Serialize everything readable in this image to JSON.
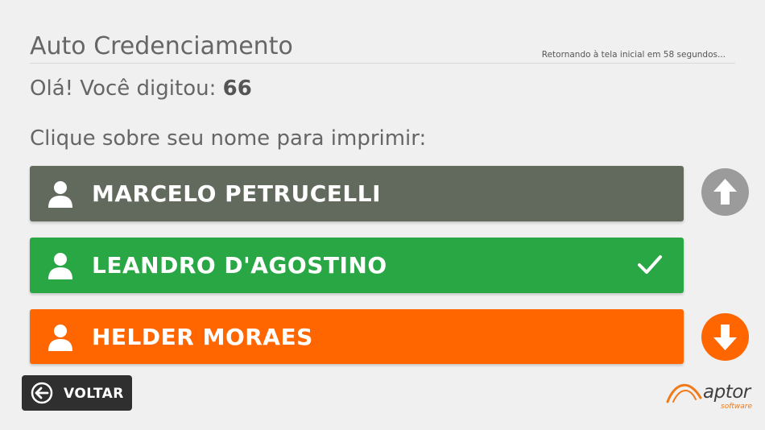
{
  "header": {
    "title": "Auto Credenciamento",
    "countdown": "Retornando à tela inicial em 58 segundos..."
  },
  "typed": {
    "prefix": "Olá! Você digitou: ",
    "value": "66"
  },
  "instruction": "Clique sobre seu nome para imprimir:",
  "names": [
    {
      "label": "MARCELO PETRUCELLI",
      "color": "#626a5d",
      "selected": false
    },
    {
      "label": "LEANDRO D'AGOSTINO",
      "color": "#29a745",
      "selected": true
    },
    {
      "label": "HELDER MORAES",
      "color": "#ff6600",
      "selected": false
    }
  ],
  "scroll": {
    "up_color": "#9b9b9b",
    "down_color": "#ff6600",
    "up_icon": "arrow-up-icon",
    "down_icon": "arrow-down-icon"
  },
  "back_button": {
    "label": "VOLTAR",
    "icon": "arrow-left-circle-icon"
  },
  "logo": {
    "word": "aptor",
    "sub": "software",
    "accent": "#f07a1a"
  }
}
